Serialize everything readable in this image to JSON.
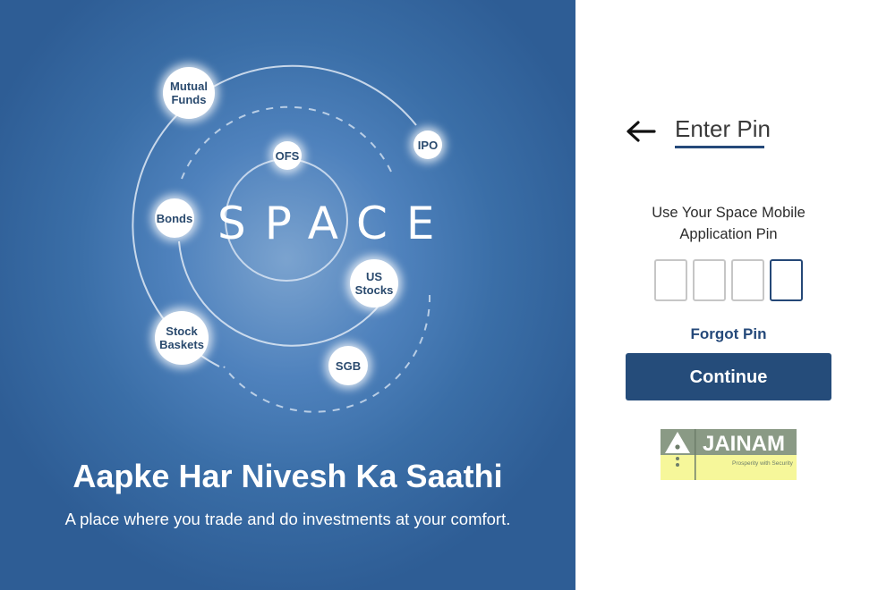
{
  "hero": {
    "brand_word": "SPACE",
    "orbit_items": [
      {
        "line1": "Mutual",
        "line2": "Funds"
      },
      {
        "line1": "IPO",
        "line2": ""
      },
      {
        "line1": "OFS",
        "line2": ""
      },
      {
        "line1": "Bonds",
        "line2": ""
      },
      {
        "line1": "US",
        "line2": "Stocks"
      },
      {
        "line1": "Stock",
        "line2": "Baskets"
      },
      {
        "line1": "SGB",
        "line2": ""
      }
    ],
    "tagline": "Aapke Har Nivesh Ka Saathi",
    "subtitle": "A place where you trade and do investments at your comfort."
  },
  "login": {
    "back_icon": "arrow-left-icon",
    "title": "Enter Pin",
    "instruction_line1": "Use Your Space Mobile",
    "instruction_line2": "Application Pin",
    "pin_values": [
      "",
      "",
      "",
      ""
    ],
    "forgot_label": "Forgot Pin",
    "continue_label": "Continue"
  },
  "logo": {
    "name": "JAINAM",
    "tagline": "Prosperity with Security"
  },
  "colors": {
    "hero_bg": "#3a6ea7",
    "accent_navy": "#254c7a",
    "logo_gray": "#8a9a85",
    "logo_yellow": "#f6f79a"
  }
}
